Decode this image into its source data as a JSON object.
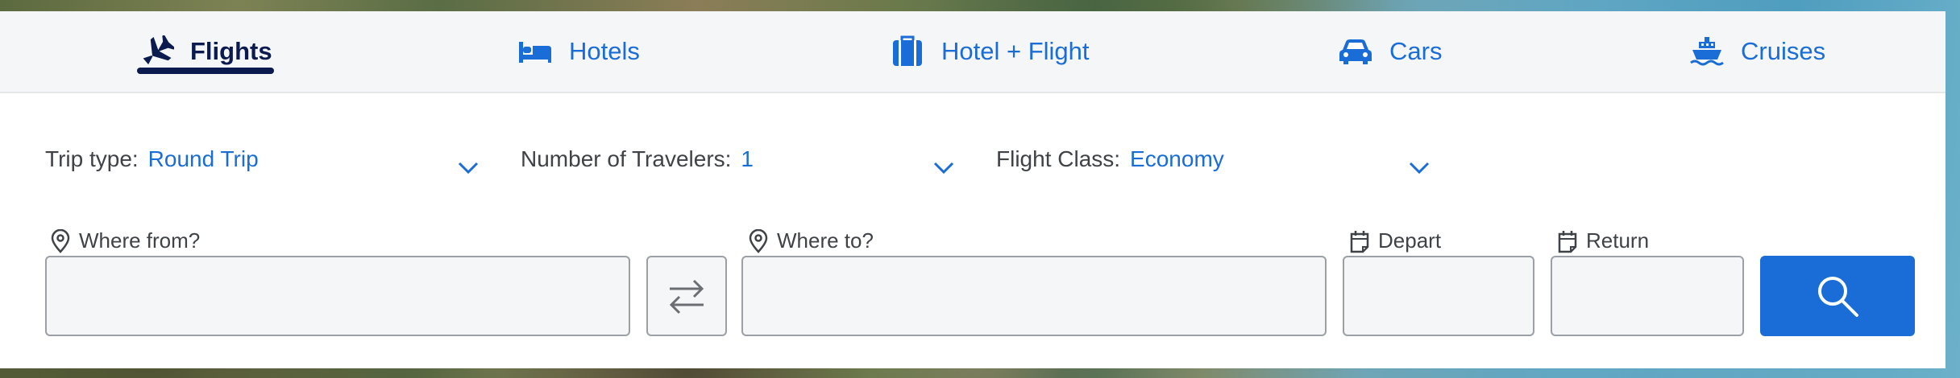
{
  "tabs": [
    {
      "label": "Flights",
      "icon": "plane-icon",
      "active": true
    },
    {
      "label": "Hotels",
      "icon": "bed-icon",
      "active": false
    },
    {
      "label": "Hotel + Flight",
      "icon": "suitcase-icon",
      "active": false
    },
    {
      "label": "Cars",
      "icon": "car-icon",
      "active": false
    },
    {
      "label": "Cruises",
      "icon": "ship-icon",
      "active": false
    }
  ],
  "selectors": {
    "trip_type": {
      "label": "Trip type:",
      "value": "Round Trip"
    },
    "travelers": {
      "label": "Number of Travelers:",
      "value": "1"
    },
    "flight_class": {
      "label": "Flight Class:",
      "value": "Economy"
    }
  },
  "fields": {
    "from": {
      "label": "Where from?",
      "value": ""
    },
    "to": {
      "label": "Where to?",
      "value": ""
    },
    "depart": {
      "label": "Depart",
      "value": ""
    },
    "return": {
      "label": "Return",
      "value": ""
    }
  },
  "colors": {
    "accent": "#1a6dd6",
    "active_tab": "#0b1a4f",
    "tab_bar_bg": "#f5f6f7",
    "input_border": "#9aa0a6"
  }
}
